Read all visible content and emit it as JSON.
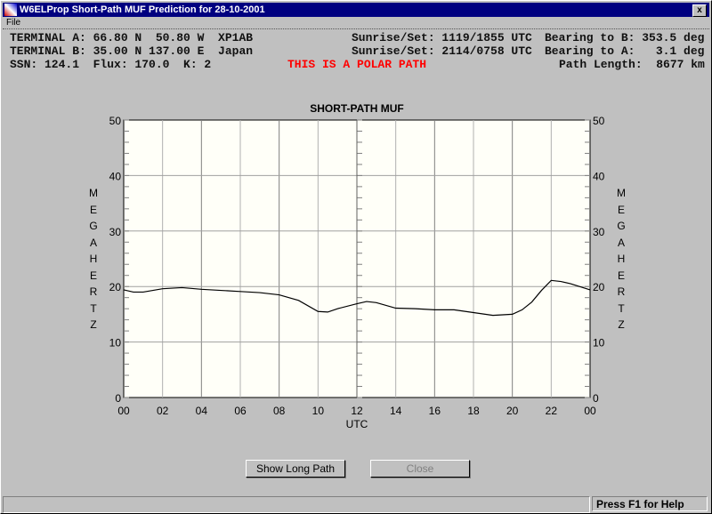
{
  "window": {
    "title": "W6ELProp Short-Path MUF Prediction for 28-10-2001",
    "close": "x"
  },
  "menu": {
    "file": "File"
  },
  "info": {
    "line1_left": "TERMINAL A: 66.80 N  50.80 W  XP1AB",
    "line1_mid": "Sunrise/Set: 1119/1855 UTC",
    "line1_right": "Bearing to B: 353.5 deg",
    "line2_left": "TERMINAL B: 35.00 N 137.00 E  Japan",
    "line2_mid": "Sunrise/Set: 2114/0758 UTC",
    "line2_right": "Bearing to A:   3.1 deg",
    "line3_left": "SSN: 124.1  Flux: 170.0  K: 2",
    "polar": "THIS IS A POLAR PATH",
    "line3_right": "Path Length:  8677 km"
  },
  "chart_data": {
    "type": "line",
    "title": "SHORT-PATH MUF",
    "xlabel": "UTC",
    "ylabel": "MEGAHERTZ",
    "xlim": [
      0,
      24
    ],
    "ylim": [
      0,
      50
    ],
    "xticks": [
      "00",
      "02",
      "04",
      "06",
      "08",
      "10",
      "12",
      "14",
      "16",
      "18",
      "20",
      "22",
      "00"
    ],
    "yticks": [
      "0",
      "10",
      "20",
      "30",
      "40",
      "50"
    ],
    "series": [
      {
        "name": "MUF",
        "x": [
          0,
          0.5,
          1,
          1.5,
          2,
          3,
          4,
          5,
          6,
          7,
          8,
          9,
          10,
          10.5,
          11,
          12,
          12.5,
          13,
          14,
          15,
          16,
          17,
          18,
          19,
          20,
          20.5,
          21,
          21.5,
          22,
          22.5,
          23,
          24
        ],
        "values": [
          19.4,
          19.0,
          19.0,
          19.3,
          19.6,
          19.8,
          19.5,
          19.3,
          19.1,
          18.9,
          18.5,
          17.5,
          15.5,
          15.4,
          16.0,
          16.9,
          17.3,
          17.1,
          16.1,
          16.0,
          15.8,
          15.8,
          15.3,
          14.8,
          15.0,
          15.8,
          17.2,
          19.3,
          21.1,
          20.9,
          20.5,
          19.4
        ]
      }
    ]
  },
  "buttons": {
    "long_path": "Show Long Path",
    "close": "Close"
  },
  "status": {
    "help": "Press F1 for Help"
  }
}
